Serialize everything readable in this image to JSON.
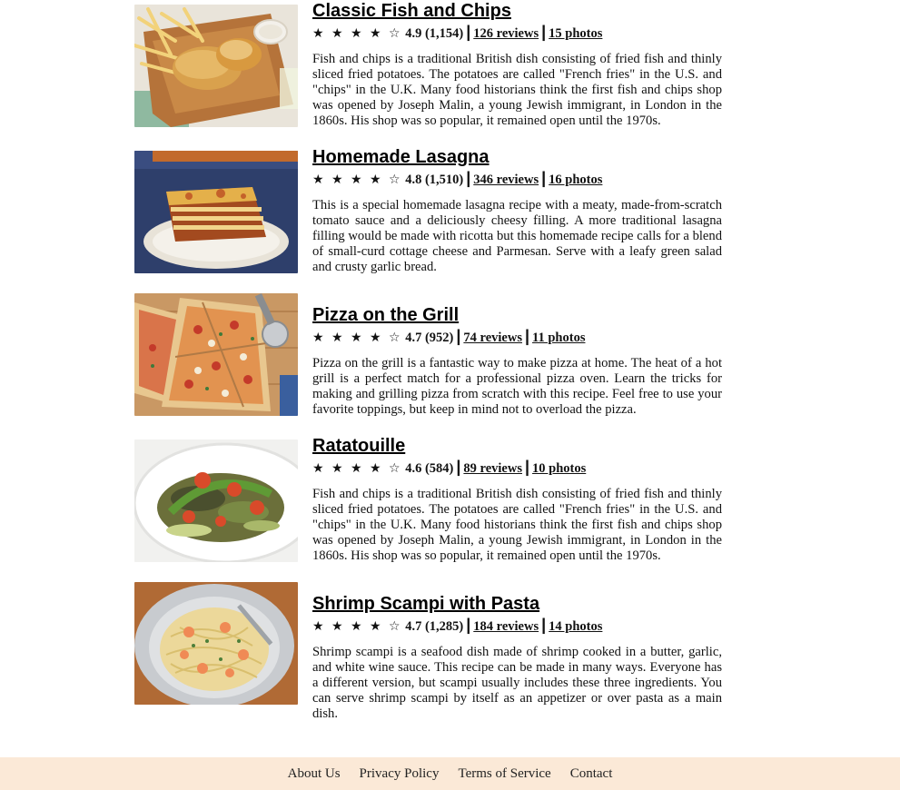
{
  "recipes": [
    {
      "title": "Classic Fish and Chips",
      "stars": "★ ★ ★ ★ ☆",
      "rating": "4.9 (1,154)",
      "reviews": "126 reviews",
      "photos": "15 photos",
      "description": "Fish and chips is a traditional British dish consisting of fried fish and thinly sliced fried potatoes. The potatoes are called \"French fries\" in the U.S. and \"chips\" in the U.K. Many food historians think the first fish and chips shop was opened by Joseph Malin, a young Jewish immigrant, in London in the 1860s. His shop was so popular, it remained open until the 1970s."
    },
    {
      "title": "Homemade Lasagna",
      "stars": "★ ★ ★ ★ ☆",
      "rating": "4.8 (1,510)",
      "reviews": "346 reviews",
      "photos": "16 photos",
      "description": "This is a special homemade lasagna recipe with a meaty, made-from-scratch tomato sauce and a deliciously cheesy filling. A more traditional lasagna filling would be made with ricotta but this homemade recipe calls for a blend of small-curd cottage cheese and Parmesan. Serve with a leafy green salad and crusty garlic bread."
    },
    {
      "title": "Pizza on the Grill",
      "stars": "★ ★ ★ ★ ☆",
      "rating": "4.7 (952)",
      "reviews": "74 reviews",
      "photos": "11 photos",
      "description": "Pizza on the grill is a fantastic way to make pizza at home. The heat of a hot grill is a perfect match for a professional pizza oven. Learn the tricks for making and grilling pizza from scratch with this recipe. Feel free to use your favorite toppings, but keep in mind not to overload the pizza."
    },
    {
      "title": "Ratatouille",
      "stars": "★ ★ ★ ★ ☆",
      "rating": "4.6 (584)",
      "reviews": "89 reviews",
      "photos": "10 photos",
      "description": "Fish and chips is a traditional British dish consisting of fried fish and thinly sliced fried potatoes. The potatoes are called \"French fries\" in the U.S. and \"chips\" in the U.K. Many food historians think the first fish and chips shop was opened by Joseph Malin, a young Jewish immigrant, in London in the 1860s. His shop was so popular, it remained open until the 1970s."
    },
    {
      "title": "Shrimp Scampi with Pasta",
      "stars": "★ ★ ★ ★ ☆",
      "rating": "4.7 (1,285)",
      "reviews": "184 reviews",
      "photos": "14 photos",
      "description": "Shrimp scampi is a seafood dish made of shrimp cooked in a butter, garlic, and white wine sauce. This recipe can be made in many ways. Everyone has a different version, but scampi usually includes these three ingredients. You can serve shrimp scampi by itself as an appetizer or over pasta as a main dish."
    }
  ],
  "footer": {
    "about": "About Us",
    "privacy": "Privacy Policy",
    "terms": "Terms of Service",
    "contact": "Contact"
  },
  "colors": {
    "footer_bg": "#fbe9d7",
    "text": "#111111"
  }
}
